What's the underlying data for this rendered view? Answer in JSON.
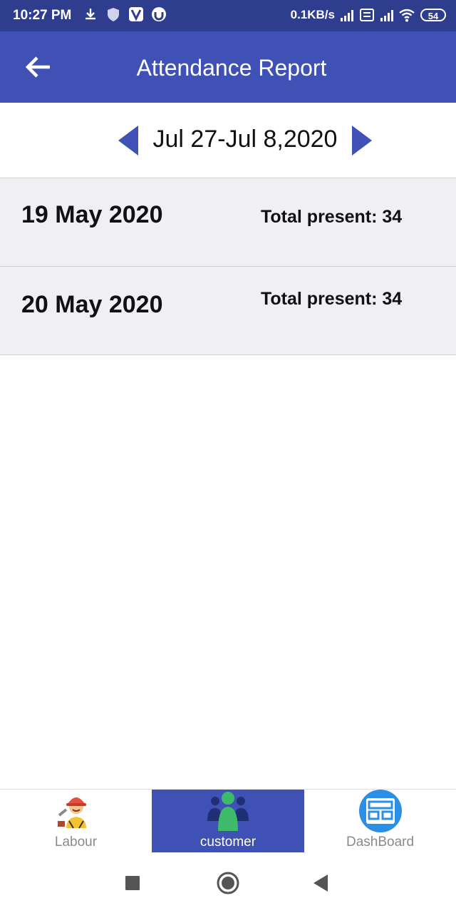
{
  "status_bar": {
    "time": "10:27 PM",
    "network_speed": "0.1KB/s",
    "battery": "54"
  },
  "app_bar": {
    "title": "Attendance Report",
    "back_icon": "arrow-left-icon"
  },
  "date_nav": {
    "range": "Jul 27-Jul 8,2020",
    "prev_icon": "triangle-left-icon",
    "next_icon": "triangle-right-icon"
  },
  "reports": [
    {
      "date": "19 May 2020",
      "total_label": "Total present:",
      "total_value": "34"
    },
    {
      "date": "20 May 2020",
      "total_label": "Total present:",
      "total_value": "34"
    }
  ],
  "bottom_nav": {
    "items": [
      {
        "label": "Labour",
        "icon": "worker-icon",
        "active": false
      },
      {
        "label": "customer",
        "icon": "users-icon",
        "active": true
      },
      {
        "label": "DashBoard",
        "icon": "dashboard-icon",
        "active": false
      }
    ]
  },
  "colors": {
    "status_bar": "#2f3d8f",
    "primary": "#3f51b5",
    "row_background": "#efeff4"
  }
}
